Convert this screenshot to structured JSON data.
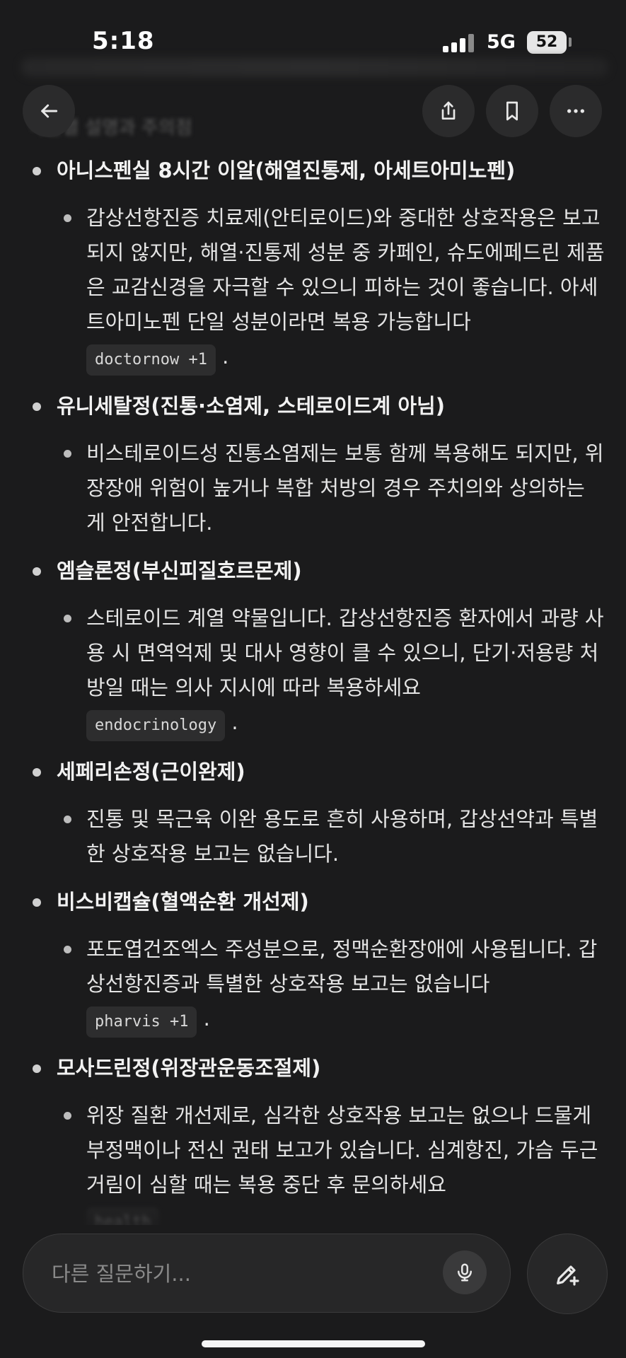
{
  "status": {
    "time": "5:18",
    "network": "5G",
    "battery": "52"
  },
  "header": {
    "title": "약물별 설명과 주의점"
  },
  "items": [
    {
      "title": "아니스펜실 8시간 이알(해열진통제, 아세트아미노펜)",
      "body": "갑상선항진증 치료제(안티로이드)와 중대한 상호작용은 보고되지 않지만, 해열·진통제 성분 중 카페인, 슈도에페드린 제품은 교감신경을 자극할 수 있으니 피하는 것이 좋습니다. 아세트아미노펜 단일 성분이라면 복용 가능합니다",
      "source": "doctornow +1"
    },
    {
      "title": "유니세탈정(진통·소염제, 스테로이드계 아님)",
      "body": "비스테로이드성 진통소염제는 보통 함께 복용해도 되지만, 위장장애 위험이 높거나 복합 처방의 경우 주치의와 상의하는 게 안전합니다.",
      "source": ""
    },
    {
      "title": "엠슬론정(부신피질호르몬제)",
      "body": "스테로이드 계열 약물입니다. 갑상선항진증 환자에서 과량 사용 시 면역억제 및 대사 영향이 클 수 있으니, 단기·저용량 처방일 때는 의사 지시에 따라 복용하세요",
      "source": "endocrinology"
    },
    {
      "title": "세페리손정(근이완제)",
      "body": "진통 및 목근육 이완 용도로 흔히 사용하며, 갑상선약과 특별한 상호작용 보고는 없습니다.",
      "source": ""
    },
    {
      "title": "비스비캡슐(혈액순환 개선제)",
      "body": "포도엽건조엑스 주성분으로, 정맥순환장애에 사용됩니다. 갑상선항진증과 특별한 상호작용 보고는 없습니다",
      "source": "pharvis +1"
    },
    {
      "title": "모사드린정(위장관운동조절제)",
      "body": "위장 질환 개선제로, 심각한 상호작용 보고는 없으나 드물게 부정맥이나 전신 권태 보고가 있습니다. 심계항진, 가슴 두근거림이 심할 때는 복용 중단 후 문의하세요",
      "source": "health"
    }
  ],
  "composer": {
    "placeholder": "다른 질문하기..."
  },
  "icons": {
    "back": "arrow-left-icon",
    "share": "share-icon",
    "bookmark": "bookmark-icon",
    "more": "more-icon",
    "mic": "mic-icon",
    "new_chat": "edit-icon"
  }
}
